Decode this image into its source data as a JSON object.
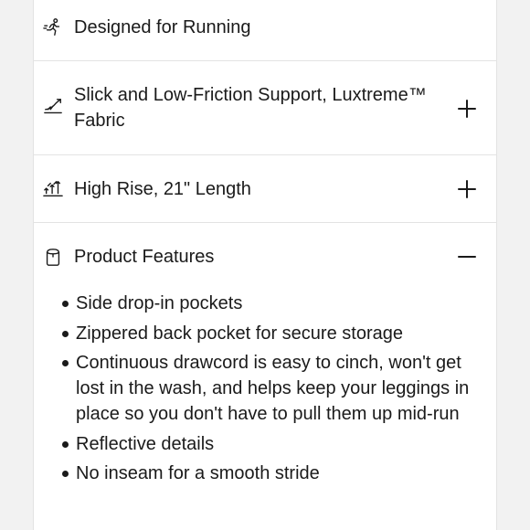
{
  "sections": [
    {
      "id": "designed",
      "icon": "running-person-icon",
      "label": "Designed for Running",
      "toggle": null
    },
    {
      "id": "fabric",
      "icon": "fabric-support-icon",
      "label": "Slick and Low-Friction Support, Luxtreme™ Fabric",
      "toggle": "expand"
    },
    {
      "id": "rise",
      "icon": "rise-length-icon",
      "label": "High Rise, 21\" Length",
      "toggle": "expand"
    },
    {
      "id": "features",
      "icon": "product-features-icon",
      "label": "Product Features",
      "toggle": "collapse"
    }
  ],
  "features": [
    "Side drop-in pockets",
    "Zippered back pocket for secure storage",
    "Continuous drawcord is easy to cinch, won't get lost in the wash, and helps keep your leggings in place so you don't have to pull them up mid-run",
    "Reflective details",
    "No inseam for a smooth stride"
  ],
  "colors": {
    "text": "#1a1a1a",
    "divider": "#e3e3e3",
    "background": "#f2f2f2",
    "panel": "#ffffff"
  }
}
